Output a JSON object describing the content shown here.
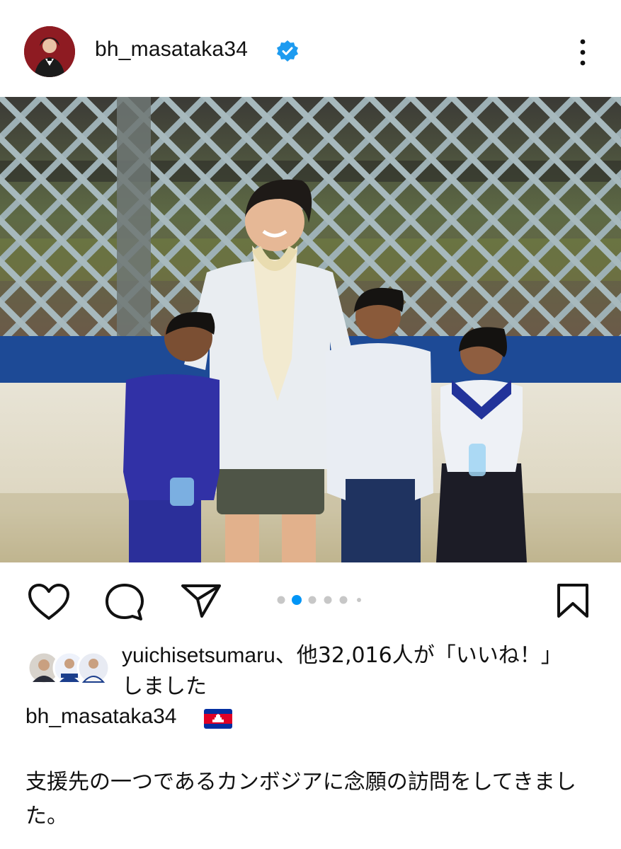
{
  "post": {
    "username": "bh_masataka34",
    "verified_icon": "verified-badge-icon",
    "more_icon": "more-vertical-icon"
  },
  "photo": {
    "carousel": {
      "count": 6,
      "active_index": 1
    }
  },
  "actions": {
    "icons": [
      "heart-icon",
      "comment-icon",
      "share-icon",
      "bookmark-icon"
    ]
  },
  "likes": {
    "user": "yuichisetsumaru",
    "rest": "、他32,016人が「いいね！」しました"
  },
  "caption": {
    "username": "bh_masataka34",
    "flag": "🇰🇭",
    "text": "支援先の一つであるカンボジアに念願の訪問をしてきました。"
  },
  "colors": {
    "verified": "#1d9bf0",
    "carousel_active": "#0095f6",
    "carousel_inactive": "#c7c7c7",
    "text": "#111111"
  }
}
